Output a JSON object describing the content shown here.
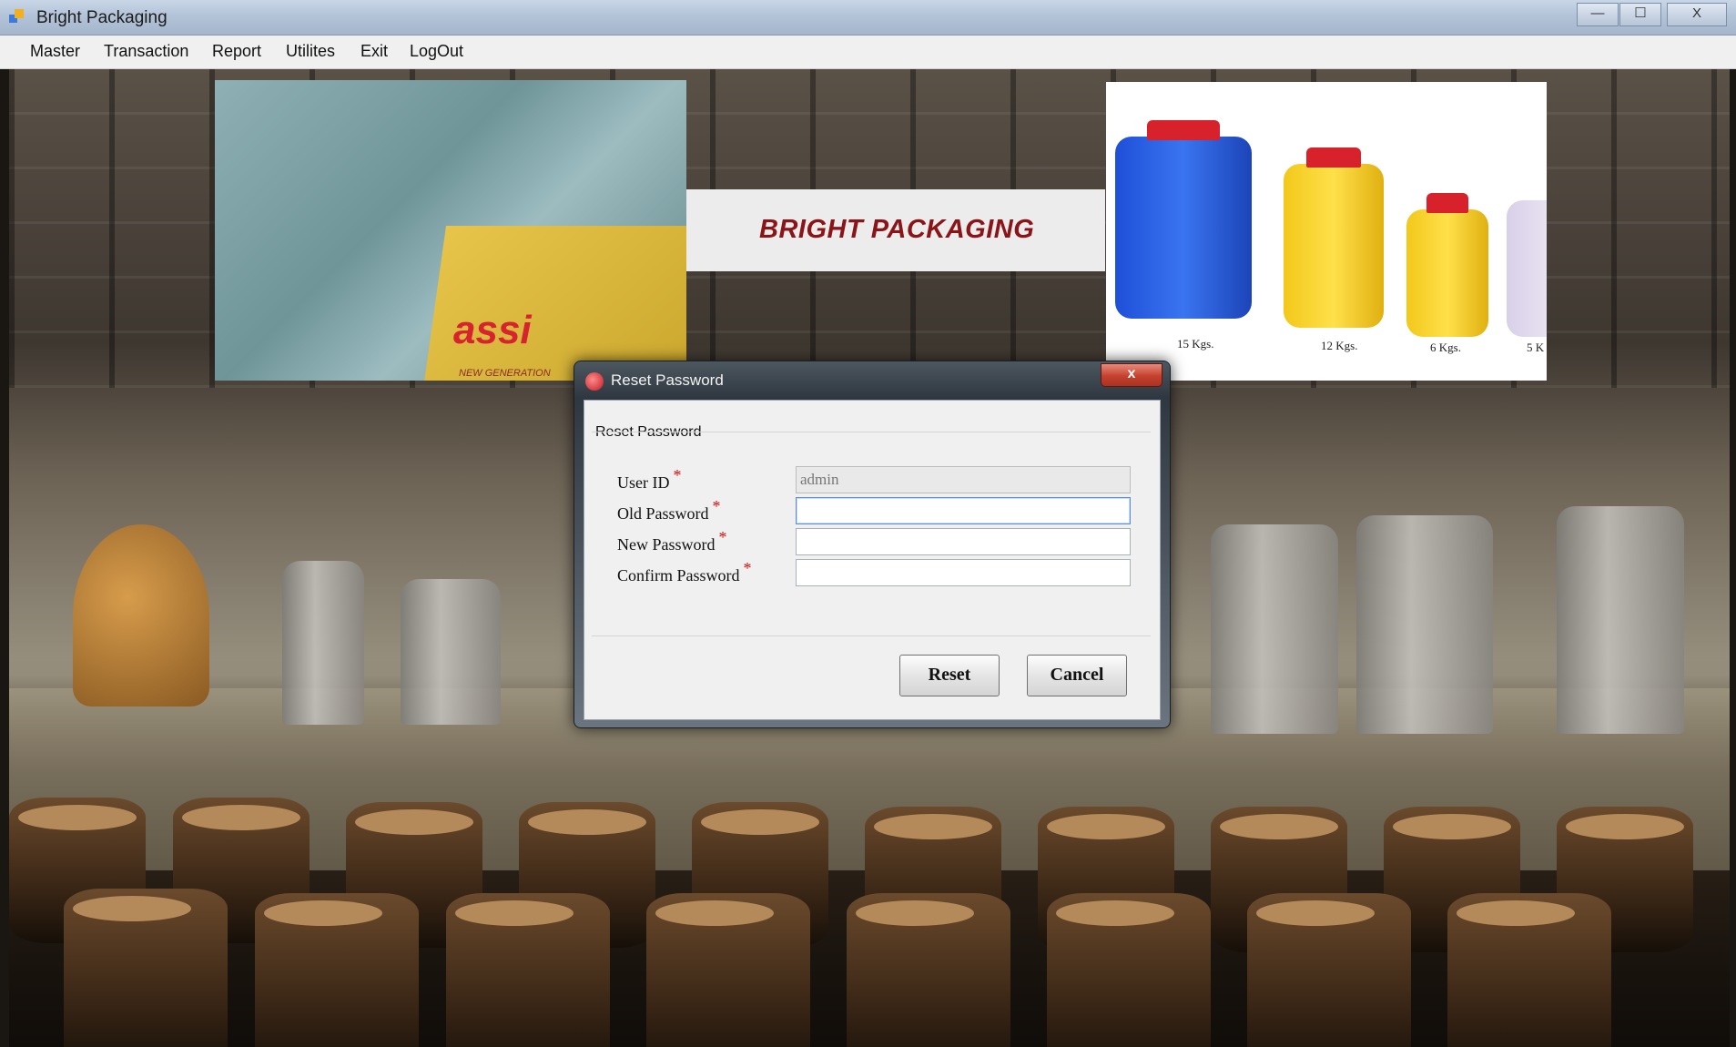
{
  "window": {
    "title": "Bright Packaging",
    "controls": {
      "minimize": "—",
      "maximize": "☐",
      "close": "X"
    }
  },
  "menu": {
    "items": [
      {
        "label": "Master"
      },
      {
        "label": "Transaction"
      },
      {
        "label": "Report"
      },
      {
        "label": "Utilites"
      },
      {
        "label": "Exit"
      },
      {
        "label": "LogOut"
      }
    ]
  },
  "banner": {
    "brand": "BRIGHT PACKAGING",
    "left_logo": "assi",
    "left_tagline": "NEW GENERATION",
    "jug_labels": [
      "15 Kgs.",
      "12 Kgs.",
      "6 Kgs.",
      "5 K"
    ]
  },
  "dialog": {
    "title": "Reset Password",
    "close_label": "x",
    "group_label": "Reset Password",
    "fields": {
      "user_id": {
        "label": "User ID",
        "value": "admin"
      },
      "old_password": {
        "label": "Old Password",
        "value": ""
      },
      "new_password": {
        "label": "New Password",
        "value": ""
      },
      "confirm_password": {
        "label": "Confirm Password",
        "value": ""
      }
    },
    "required_marker": "*",
    "buttons": {
      "reset": "Reset",
      "cancel": "Cancel"
    }
  },
  "colors": {
    "brand_text": "#8b1419",
    "required_marker": "#d01010",
    "close_button": "#c4412e"
  }
}
